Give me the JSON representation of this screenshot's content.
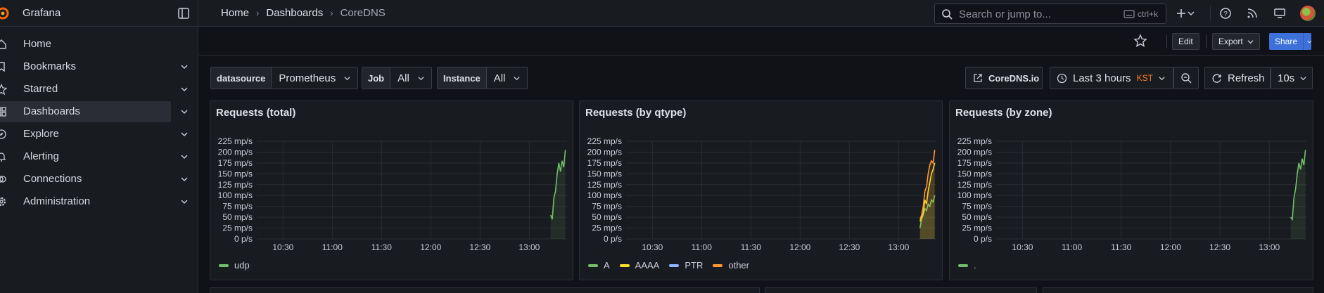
{
  "app": {
    "name": "Grafana"
  },
  "breadcrumb": [
    "Home",
    "Dashboards",
    "CoreDNS"
  ],
  "search": {
    "placeholder": "Search or jump to...",
    "shortcut": "ctrl+k"
  },
  "sidebar": {
    "items": [
      {
        "label": "Home",
        "icon": "home-icon",
        "expandable": false
      },
      {
        "label": "Bookmarks",
        "icon": "bookmark-icon",
        "expandable": true
      },
      {
        "label": "Starred",
        "icon": "star-icon",
        "expandable": true
      },
      {
        "label": "Dashboards",
        "icon": "apps-icon",
        "expandable": true,
        "active": true
      },
      {
        "label": "Explore",
        "icon": "compass-icon",
        "expandable": true
      },
      {
        "label": "Alerting",
        "icon": "bell-icon",
        "expandable": true
      },
      {
        "label": "Connections",
        "icon": "link-icon",
        "expandable": true
      },
      {
        "label": "Administration",
        "icon": "cog-icon",
        "expandable": true
      }
    ]
  },
  "toolbar": {
    "edit_label": "Edit",
    "export_label": "Export",
    "share_label": "Share"
  },
  "variables": {
    "datasource": {
      "label": "datasource",
      "value": "Prometheus"
    },
    "job": {
      "label": "Job",
      "value": "All"
    },
    "instance": {
      "label": "Instance",
      "value": "All"
    }
  },
  "controls": {
    "link_label": "CoreDNS.io",
    "time_range": "Last 3 hours",
    "timezone": "KST",
    "refresh_label": "Refresh",
    "refresh_interval": "10s"
  },
  "colors": {
    "accent": "#3d71d9",
    "green": "#73bf69",
    "yellow": "#fade2a",
    "blue": "#8ab8ff",
    "orange": "#ff9830",
    "tz": "#ff7f2a"
  },
  "panels": [
    {
      "title": "Requests (total)",
      "chart_data": {
        "type": "line",
        "x_ticks": [
          "10:30",
          "11:00",
          "11:30",
          "12:00",
          "12:30",
          "13:00"
        ],
        "y_ticks": [
          "225 mp/s",
          "200 mp/s",
          "175 mp/s",
          "150 mp/s",
          "125 mp/s",
          "100 mp/s",
          "75 mp/s",
          "50 mp/s",
          "25 mp/s",
          "0 p/s"
        ],
        "ylim": [
          0,
          225
        ],
        "series": [
          {
            "name": "udp",
            "color": "#73bf69",
            "x": [
              "13:13",
              "13:14",
              "13:15",
              "13:16",
              "13:17",
              "13:18",
              "13:19",
              "13:20",
              "13:21",
              "13:22"
            ],
            "values": [
              55,
              45,
              95,
              110,
              150,
              175,
              155,
              180,
              165,
              205
            ]
          }
        ]
      }
    },
    {
      "title": "Requests (by qtype)",
      "chart_data": {
        "type": "line",
        "x_ticks": [
          "10:30",
          "11:00",
          "11:30",
          "12:00",
          "12:30",
          "13:00"
        ],
        "y_ticks": [
          "225 mp/s",
          "200 mp/s",
          "175 mp/s",
          "150 mp/s",
          "125 mp/s",
          "100 mp/s",
          "75 mp/s",
          "50 mp/s",
          "25 mp/s",
          "0 p/s"
        ],
        "ylim": [
          0,
          225
        ],
        "series": [
          {
            "name": "A",
            "color": "#73bf69",
            "x": [
              "13:13",
              "13:14",
              "13:15",
              "13:16",
              "13:17",
              "13:18",
              "13:19",
              "13:20",
              "13:21",
              "13:22"
            ],
            "values": [
              25,
              45,
              55,
              70,
              65,
              80,
              75,
              90,
              85,
              100
            ]
          },
          {
            "name": "AAAA",
            "color": "#fade2a",
            "x": [
              "13:13",
              "13:14",
              "13:15",
              "13:16",
              "13:17",
              "13:18",
              "13:19",
              "13:20",
              "13:21",
              "13:22"
            ],
            "values": [
              40,
              50,
              60,
              90,
              80,
              110,
              130,
              150,
              160,
              175
            ]
          },
          {
            "name": "PTR",
            "color": "#8ab8ff",
            "x": [
              "13:13",
              "13:14",
              "13:15",
              "13:16",
              "13:17",
              "13:18",
              "13:19",
              "13:20",
              "13:21",
              "13:22"
            ],
            "values": [
              0,
              0,
              0,
              0,
              0,
              0,
              0,
              0,
              0,
              0
            ]
          },
          {
            "name": "other",
            "color": "#ff9830",
            "x": [
              "13:13",
              "13:14",
              "13:15",
              "13:16",
              "13:17",
              "13:18",
              "13:19",
              "13:20",
              "13:21",
              "13:22"
            ],
            "values": [
              45,
              55,
              75,
              110,
              120,
              150,
              170,
              180,
              175,
              205
            ]
          }
        ]
      }
    },
    {
      "title": "Requests (by zone)",
      "chart_data": {
        "type": "line",
        "x_ticks": [
          "10:30",
          "11:00",
          "11:30",
          "12:00",
          "12:30",
          "13:00"
        ],
        "y_ticks": [
          "225 mp/s",
          "200 mp/s",
          "175 mp/s",
          "150 mp/s",
          "125 mp/s",
          "100 mp/s",
          "75 mp/s",
          "50 mp/s",
          "25 mp/s",
          "0 p/s"
        ],
        "ylim": [
          0,
          225
        ],
        "series": [
          {
            "name": ".",
            "color": "#73bf69",
            "x": [
              "13:13",
              "13:14",
              "13:15",
              "13:16",
              "13:17",
              "13:18",
              "13:19",
              "13:20",
              "13:21",
              "13:22"
            ],
            "values": [
              50,
              45,
              95,
              115,
              150,
              175,
              160,
              185,
              170,
              205
            ]
          }
        ]
      }
    }
  ]
}
